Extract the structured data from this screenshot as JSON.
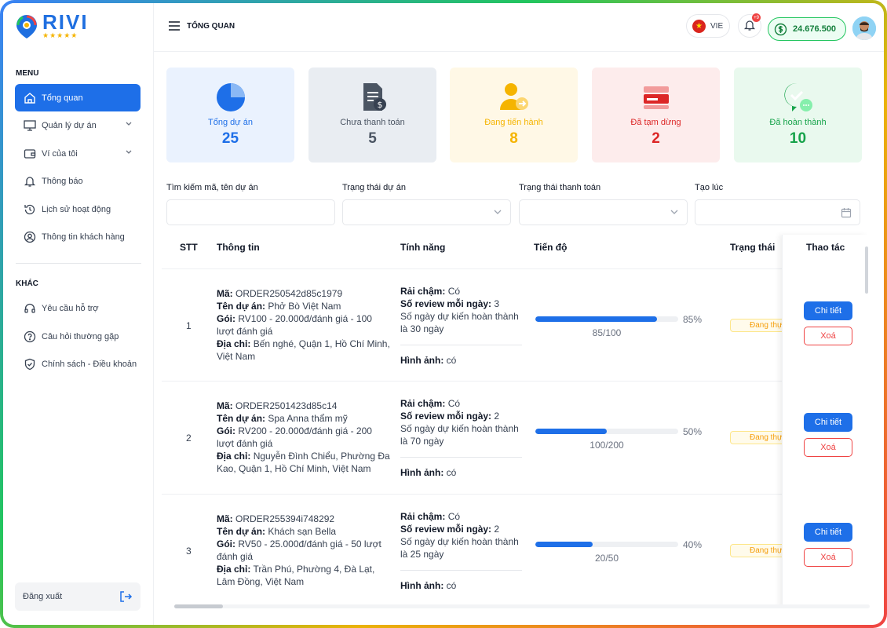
{
  "brand": {
    "name": "RIVI",
    "stars": "★★★★★"
  },
  "sidebar": {
    "menu_title": "MENU",
    "items": [
      {
        "label": "Tổng quan",
        "icon": "home-icon"
      },
      {
        "label": "Quản lý dự án",
        "icon": "presentation-icon"
      },
      {
        "label": "Ví của tôi",
        "icon": "wallet-icon"
      },
      {
        "label": "Thông báo",
        "icon": "bell-icon"
      },
      {
        "label": "Lịch sử hoạt động",
        "icon": "history-icon"
      },
      {
        "label": "Thông tin khách hàng",
        "icon": "user-circle-icon"
      }
    ],
    "other_title": "KHÁC",
    "other_items": [
      {
        "label": "Yêu cầu hỗ trợ",
        "icon": "headset-icon"
      },
      {
        "label": "Câu hỏi thường gặp",
        "icon": "help-circle-icon"
      },
      {
        "label": "Chính sách - Điều khoản",
        "icon": "shield-icon"
      }
    ],
    "logout_label": "Đăng xuất"
  },
  "header": {
    "title": "TỔNG QUAN",
    "language": "VIE",
    "notification_count": "+9",
    "balance": "24.676.500"
  },
  "cards": [
    {
      "label": "Tổng dự án",
      "value": "25",
      "color": "#1e6fe8",
      "bg": "#eaf2fe"
    },
    {
      "label": "Chưa thanh toán",
      "value": "5",
      "color": "#4b5563",
      "bg": "#e9edf2"
    },
    {
      "label": "Đang tiến hành",
      "value": "8",
      "color": "#f5b400",
      "bg": "#fff8e6"
    },
    {
      "label": "Đã tạm dừng",
      "value": "2",
      "color": "#dc2626",
      "bg": "#fdecec"
    },
    {
      "label": "Đã hoàn thành",
      "value": "10",
      "color": "#16a34a",
      "bg": "#e9f9ee"
    }
  ],
  "filters": {
    "search_label": "Tìm kiếm mã, tên dự án",
    "status_label": "Trạng thái dự án",
    "payment_label": "Trạng thái thanh toán",
    "created_label": "Tạo lúc"
  },
  "table": {
    "headers": {
      "stt": "STT",
      "info": "Thông tin",
      "features": "Tính năng",
      "progress": "Tiến độ",
      "status": "Trạng thái",
      "actions": "Thao tác"
    },
    "labels": {
      "code": "Mã:",
      "name": "Tên dự án:",
      "package": "Gói:",
      "address": "Địa chỉ:",
      "slow_drip": "Rải chậm:",
      "reviews_per_day": "Số review mỗi ngày:",
      "images": "Hình ảnh:",
      "detail_btn": "Chi tiết",
      "delete_btn": "Xoá"
    },
    "rows": [
      {
        "stt": "1",
        "code": "ORDER250542d85c1979",
        "name": "Phở Bò Việt Nam",
        "package": "RV100 - 20.000đ/đánh giá - 100 lượt đánh giá",
        "address": "Bến nghé, Quận 1, Hồ Chí Minh, Việt Nam",
        "slow_drip": "Có",
        "reviews_per_day": "3",
        "expected": "Số ngày dự kiến hoàn thành là 30 ngày",
        "images": "có",
        "progress": 0.85,
        "progress_pct": "85%",
        "progress_count": "85/100",
        "status": "Đang thực hiện"
      },
      {
        "stt": "2",
        "code": "ORDER2501423d85c14",
        "name": "Spa Anna thẩm mỹ",
        "package": "RV200 - 20.000đ/đánh giá - 200 lượt đánh giá",
        "address": "Nguyễn Đình Chiểu, Phường Đa Kao, Quận 1, Hồ Chí Minh, Việt Nam",
        "slow_drip": "Có",
        "reviews_per_day": "2",
        "expected": "Số ngày dự kiến hoàn thành là 70 ngày",
        "images": "có",
        "progress": 0.5,
        "progress_pct": "50%",
        "progress_count": "100/200",
        "status": "Đang thực hiện"
      },
      {
        "stt": "3",
        "code": "ORDER255394i748292",
        "name": "Khách sạn Bella",
        "package": "RV50 - 25.000đ/đánh giá - 50 lượt đánh giá",
        "address": "Trần Phú, Phường 4, Đà Lạt, Lâm Đồng, Việt Nam",
        "slow_drip": "Có",
        "reviews_per_day": "2",
        "expected": "Số ngày dự kiến hoàn thành là 25 ngày",
        "images": "có",
        "progress": 0.4,
        "progress_pct": "40%",
        "progress_count": "20/50",
        "status": "Đang thực hiện"
      }
    ]
  }
}
